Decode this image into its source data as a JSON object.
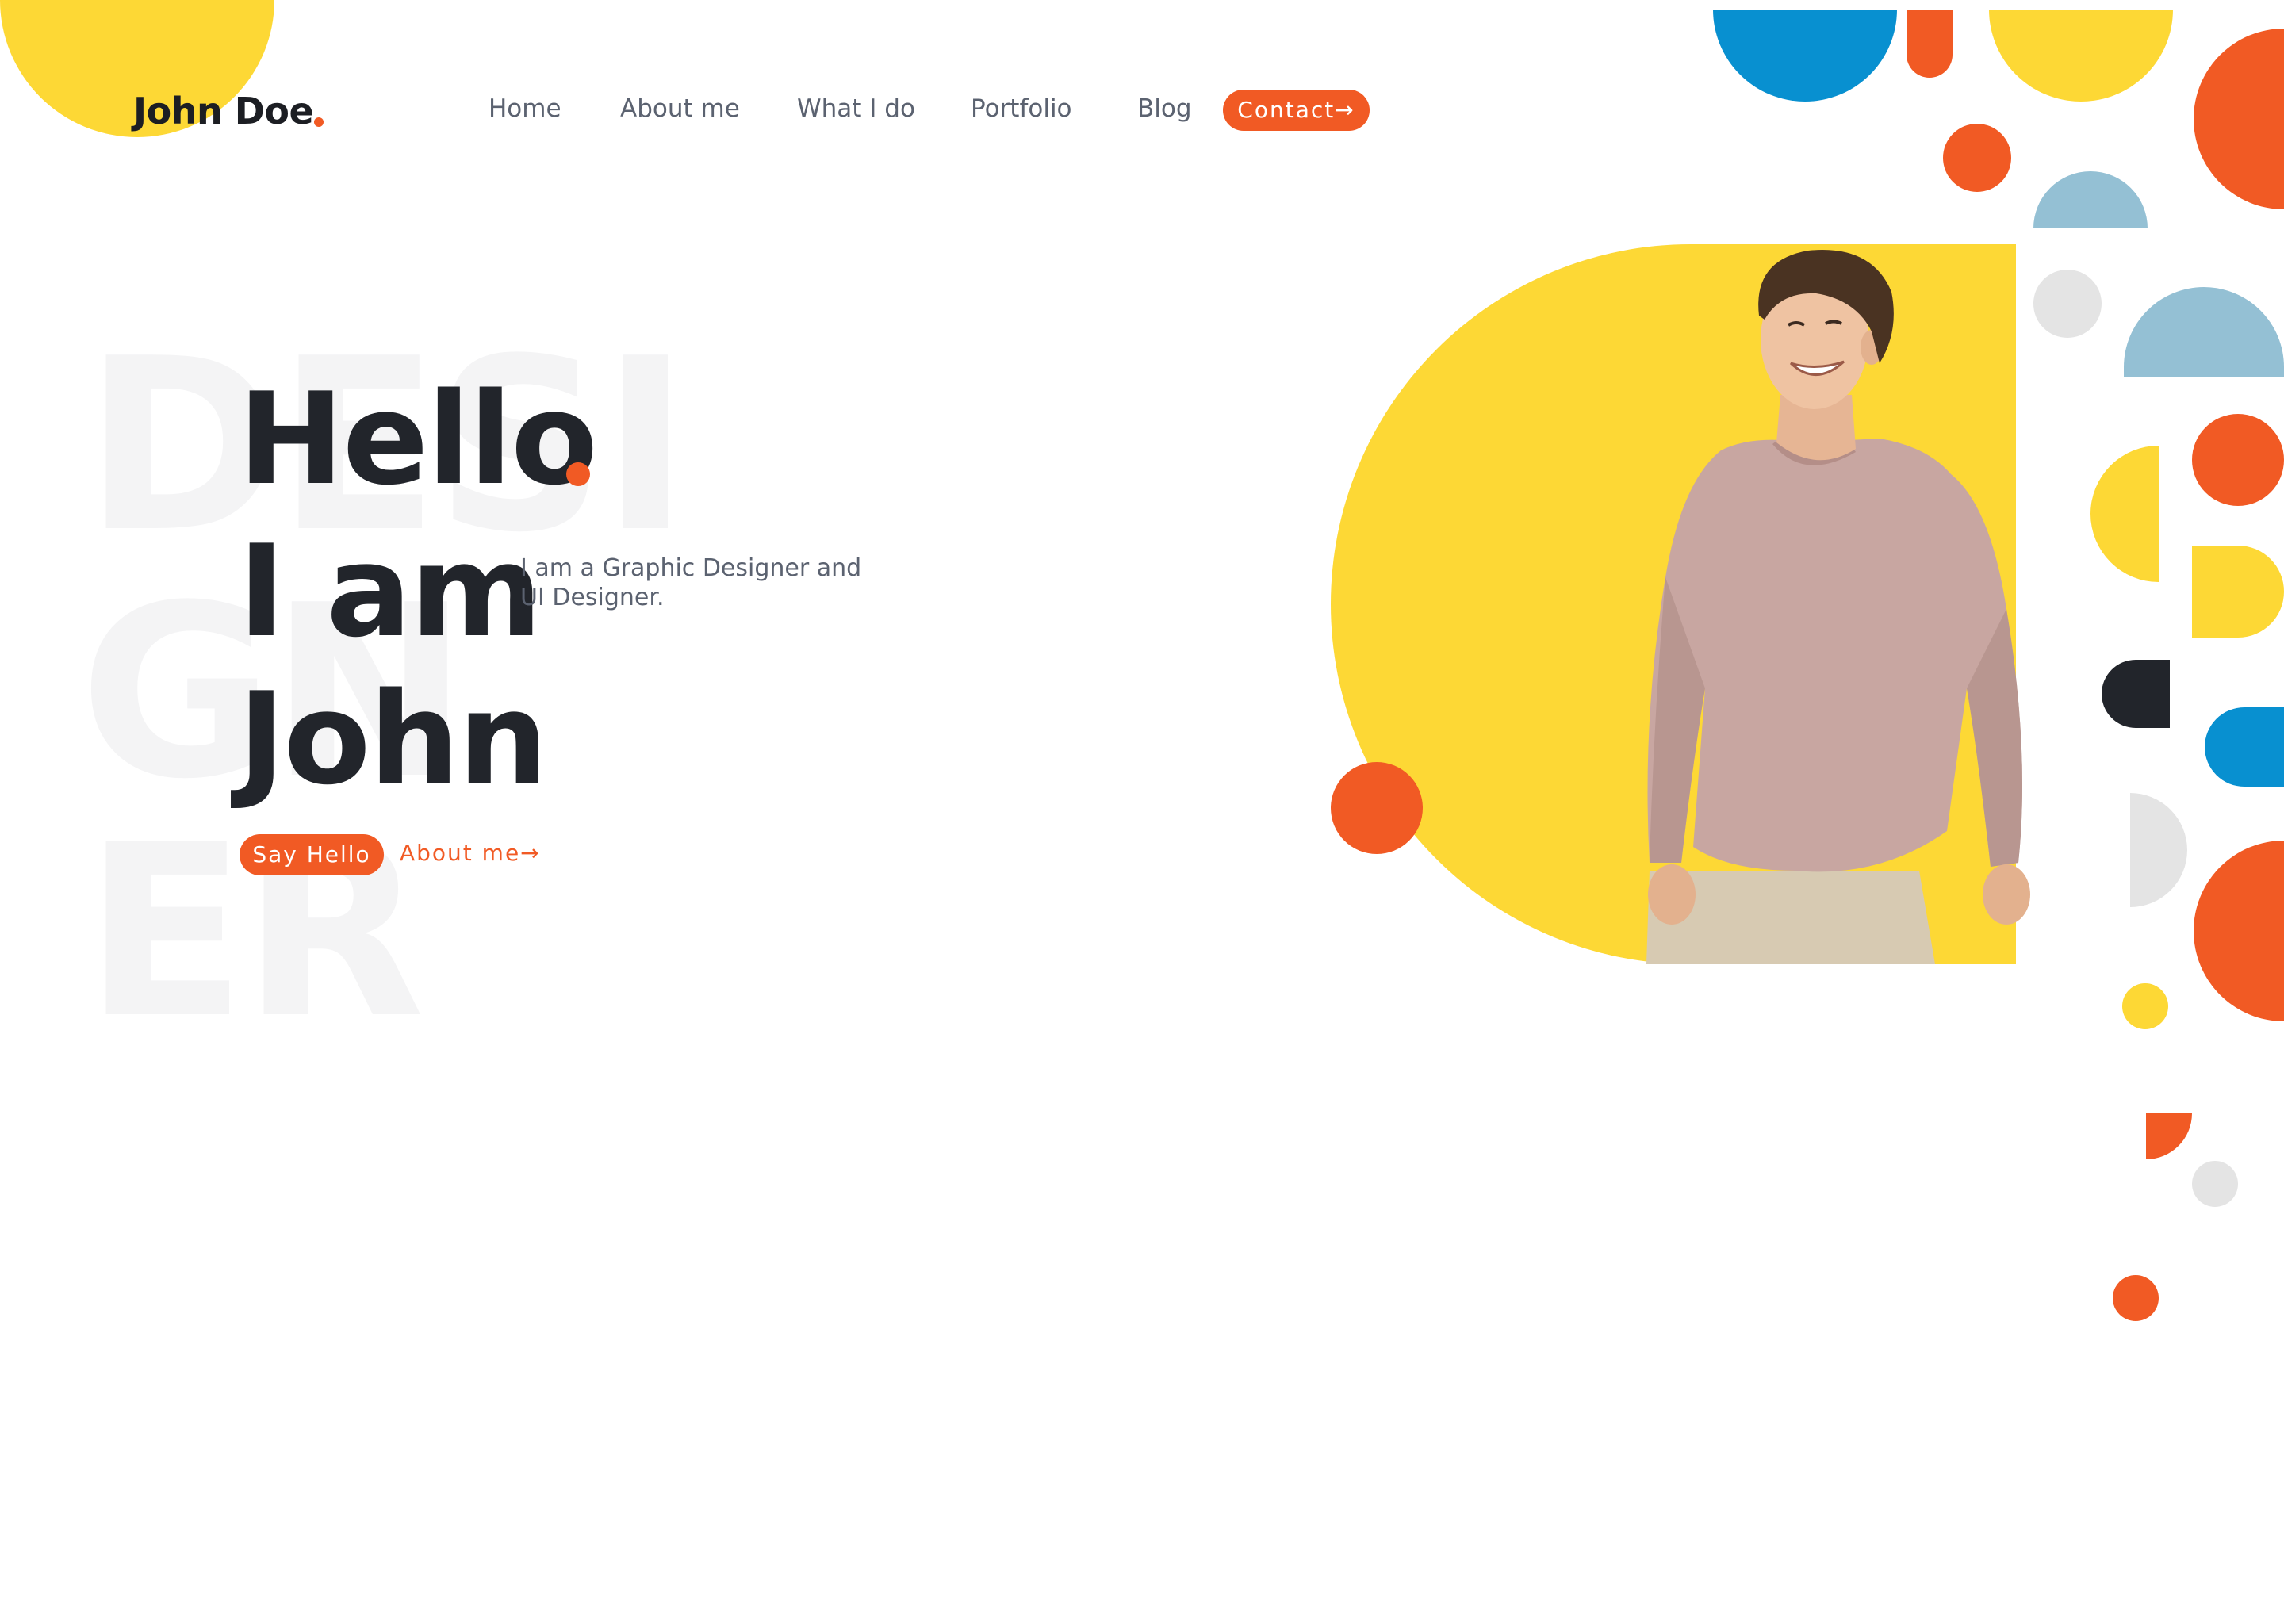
{
  "brand": {
    "name": "John Doe",
    "accent_color": "#f15a24",
    "yellow": "#fdd835"
  },
  "nav": {
    "items": [
      "Home",
      "About me",
      "What I do",
      "Portfolio",
      "Blog"
    ],
    "contact_label": "Contact→"
  },
  "hero": {
    "background_word": [
      "DESI",
      "GN",
      "ER"
    ],
    "lines": [
      "Hello",
      "I am",
      "John"
    ],
    "subtitle": "I am a Graphic Designer and UI Designer.",
    "say_hello_label": "Say Hello",
    "about_label": "About me→"
  }
}
